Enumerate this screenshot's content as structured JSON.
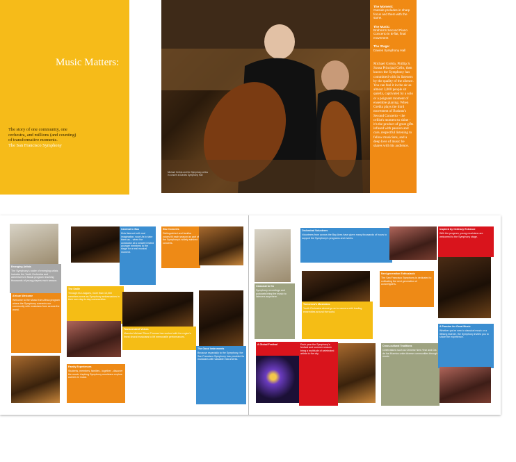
{
  "cover": {
    "title": "Music Matters:",
    "blurb": "The story of one community, one orchestra, and millions (and counting) of transformative moments.",
    "credit": "The San Francisco Symphony"
  },
  "spread": {
    "sidebar": [
      {
        "heading": "The Moment:",
        "body": "Outside preludes in sharp focus and them with the same."
      },
      {
        "heading": "The Music:",
        "body": "Brahms's Second Piano Concerto in B-flat, final movement"
      },
      {
        "heading": "The Stage:",
        "body": "Davies Symphony Hall"
      }
    ],
    "story": "Michael Grebla, Phillip S. Sousa Principal Cello, then knows the Symphony has committed with its listeners by the quality of the silence. You can feel it in the air as almost 3,000 people sit quietly, captivated by a solo or a poignant moment of ensemble playing. When Grebla plays the third movement of Brahms's Second Concerto - the cellist's moment to shine - it's the product of great gifts infused with passion and care, respectful listening to fellow musicians, and a deep love of music he shares with his audience.",
    "photo_caption": "Michael Grebla and the Symphony cellos in concert at Davies Symphony Hall"
  },
  "book": {
    "cards": [
      {
        "id": "emerging-artists",
        "title": "Emerging Artists",
        "body": "The Symphony's roster of emerging artists includes the Youth Orchestra and Adventures in Music program reaching thousands of young players each season."
      },
      {
        "id": "african-welcome",
        "title": "African Welcome",
        "body": "Welcome to the Music from Africa program where the Symphony connects our community with musicians from across the world."
      },
      {
        "id": "carnival-bus",
        "title": "Carnival in Bus",
        "body": "Kids listened with real imagination, wow! As to take them as... when the conductor at a concert invited younger members to the stage for a real musical moment."
      },
      {
        "id": "the-smile",
        "title": "The Smile",
        "body": "Through its Leagues, more than 10,000 members serve as Symphony ambassadors in their own day-to-day communities."
      },
      {
        "id": "star-concerts",
        "title": "Star Concerts",
        "body": "Distinguished and familiar voices fill each season as part of the Symphony's widely admired concerts."
      },
      {
        "id": "transcendent-voices",
        "title": "Transcendent Voices",
        "body": "Maestro Michael Tilson Thomas has worked with the region's finest choral musicians to lift memorable performances."
      },
      {
        "id": "family-experiences",
        "title": "Family Experiences",
        "body": "Students, members, families - together - discover the music. Aspiring Symphony musicians explore careers in music."
      },
      {
        "id": "good-instruments",
        "title": "The Good Instruments",
        "body": "Because especially to the Symphony, the San Francisco Symphony has provided its musicians with valuable instruments."
      },
      {
        "id": "orchestral-volunteers",
        "title": "Orchestral Volunteers",
        "body": "Volunteers from across the Bay Area have given many thousands of hours to support the Symphony's programs and events."
      },
      {
        "id": "classical-go",
        "title": "Classical to Go",
        "body": "Symphony recordings and podcasts bring the music to listeners anywhere."
      },
      {
        "id": "tomorrows-musicians",
        "title": "Tomorrow's Musicians",
        "body": "Youth Orchestra alumni go on to careers with leading ensembles around the world."
      },
      {
        "id": "next-gen",
        "title": "Next-generation Enthusiasts",
        "body": "The San Francisco Symphony is dedicated to cultivating the next generation of concertgoers."
      },
      {
        "id": "global-festival",
        "title": "A Global Festival",
        "body": "Each year the Symphony's festival and summer season bring a multitude of celebrated artists to the city."
      },
      {
        "id": "cross-cultural",
        "title": "Cross-cultural Traditions",
        "body": "Celebrations such as Chinese New Year and Dia de los Muertos unite diverse communities through music."
      },
      {
        "id": "inspired-by-ordinary",
        "title": "Inspired by Ordinary Entrance",
        "body": "With the program, young musicians are welcomed to the Symphony stage."
      },
      {
        "id": "passion-music",
        "title": "A Passion for Great Music",
        "body": "Whether you're new to classical music or a lifelong listener, the Symphony invites you to share the experience."
      }
    ]
  }
}
